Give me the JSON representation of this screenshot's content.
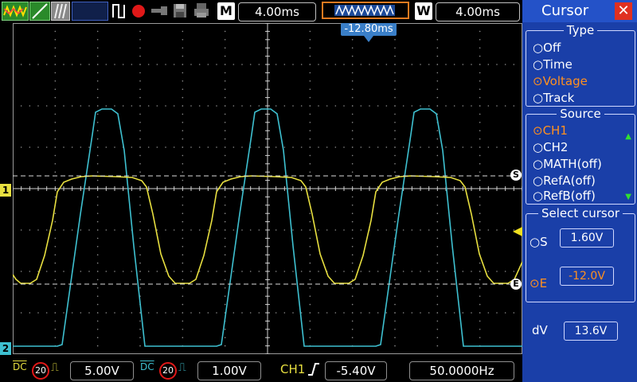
{
  "colors": {
    "ch1": "#e8e040",
    "ch2": "#3ec0d0",
    "panel": "#1a3fa8",
    "accent": "#ff9020"
  },
  "topbar": {
    "icons": [
      "waveform-icon",
      "edge-icon",
      "persistence-icon",
      "pulse-icon",
      "record-icon",
      "key-icon",
      "save-icon",
      "print-icon"
    ],
    "m_label": "M",
    "m_time": "4.00ms",
    "w_label": "W",
    "w_time": "4.00ms",
    "trigger_position": "-12.80ms"
  },
  "scope": {
    "ch1_marker": "1",
    "ch2_marker": "2",
    "cursor_s": "S",
    "cursor_e": "E"
  },
  "panel": {
    "title": "Cursor",
    "type": {
      "title": "Type",
      "options": [
        "Off",
        "Time",
        "Voltage",
        "Track"
      ],
      "selected": 2
    },
    "source": {
      "title": "Source",
      "options": [
        "CH1",
        "CH2",
        "MATH(off)",
        "RefA(off)",
        "RefB(off)"
      ],
      "selected": 0
    },
    "select_cursor": {
      "title": "Select cursor",
      "s_label": "S",
      "s_value": "1.60V",
      "e_label": "E",
      "e_value": "-12.0V"
    },
    "dv_label": "dV",
    "dv_value": "13.6V"
  },
  "bottombar": {
    "ch1_coupling": "DC",
    "ch1_bw": "20",
    "ch1_scale": "5.00V",
    "ch2_coupling": "DC",
    "ch2_bw": "20",
    "ch2_scale": "1.00V",
    "trigger_source": "CH1",
    "trigger_level": "-5.40V",
    "frequency": "50.0000Hz"
  }
}
